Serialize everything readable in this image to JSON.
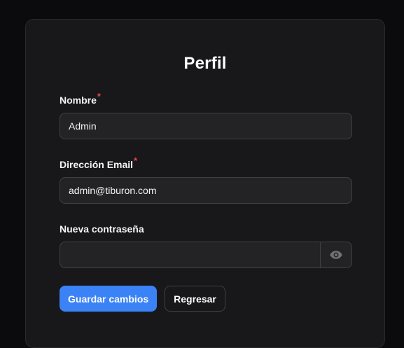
{
  "page": {
    "title": "Perfil"
  },
  "form": {
    "name": {
      "label": "Nombre",
      "required_mark": "*",
      "value": "Admin"
    },
    "email": {
      "label": "Dirección Email",
      "required_mark": "*",
      "value": "admin@tiburon.com"
    },
    "password": {
      "label": "Nueva contraseña",
      "value": "",
      "toggle_icon": "eye-icon"
    }
  },
  "actions": {
    "save_label": "Guardar cambios",
    "back_label": "Regresar"
  },
  "colors": {
    "background": "#0b0b0d",
    "card": "#18181b",
    "primary": "#3b82f6",
    "required": "#ef4444"
  }
}
